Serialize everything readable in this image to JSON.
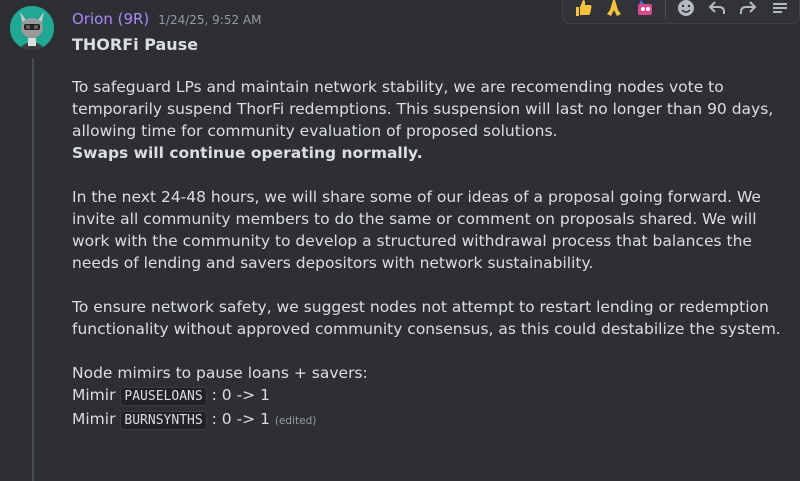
{
  "message": {
    "author": "Orion (9R)",
    "timestamp": "1/24/25, 9:52 AM",
    "title": "THORFi Pause",
    "paragraph1": "To safeguard LPs and maintain network stability, we are recomending nodes vote to temporarily suspend ThorFi redemptions. This suspension will last no longer than 90 days, allowing time for community evaluation of proposed solutions.",
    "paragraph1_bold": "Swaps will continue operating normally.",
    "paragraph2": "In the next 24-48 hours, we will share some of our ideas of a proposal going forward. We invite all community members to do the same or comment on proposals shared. We will work with the community to develop a structured withdrawal process that balances the needs of lending and savers depositors with network sustainability.",
    "paragraph3": "To ensure network safety, we suggest nodes not attempt to restart lending or redemption functionality without approved community consensus, as this could destabilize the system.",
    "mimir_heading": "Node mimirs to pause loans + savers:",
    "mimir_lines": [
      {
        "prefix": "Mimir",
        "code": "PAUSELOANS",
        "suffix": ": 0 -> 1"
      },
      {
        "prefix": "Mimir",
        "code": "BURNSYNTHS",
        "suffix": ": 0 -> 1"
      }
    ],
    "edited_label": "(edited)"
  },
  "toolbar": {
    "reactions": [
      {
        "icon": "thumbs-up-icon",
        "glyph": "👍"
      },
      {
        "icon": "praying-hands-icon",
        "glyph": "🙏"
      },
      {
        "icon": "custom-emoji-icon",
        "glyph": "🎉"
      }
    ],
    "actions": [
      {
        "icon": "add-reaction-icon",
        "glyph": "☺"
      },
      {
        "icon": "reply-icon",
        "glyph": "↶"
      },
      {
        "icon": "forward-icon",
        "glyph": "↷"
      },
      {
        "icon": "create-thread-icon",
        "glyph": "≡"
      }
    ]
  },
  "colors": {
    "background": "#2e2f34",
    "author": "#a78bfa",
    "text": "#dbdee1",
    "muted": "#949ba4",
    "avatar_bg": "#1fa893"
  }
}
